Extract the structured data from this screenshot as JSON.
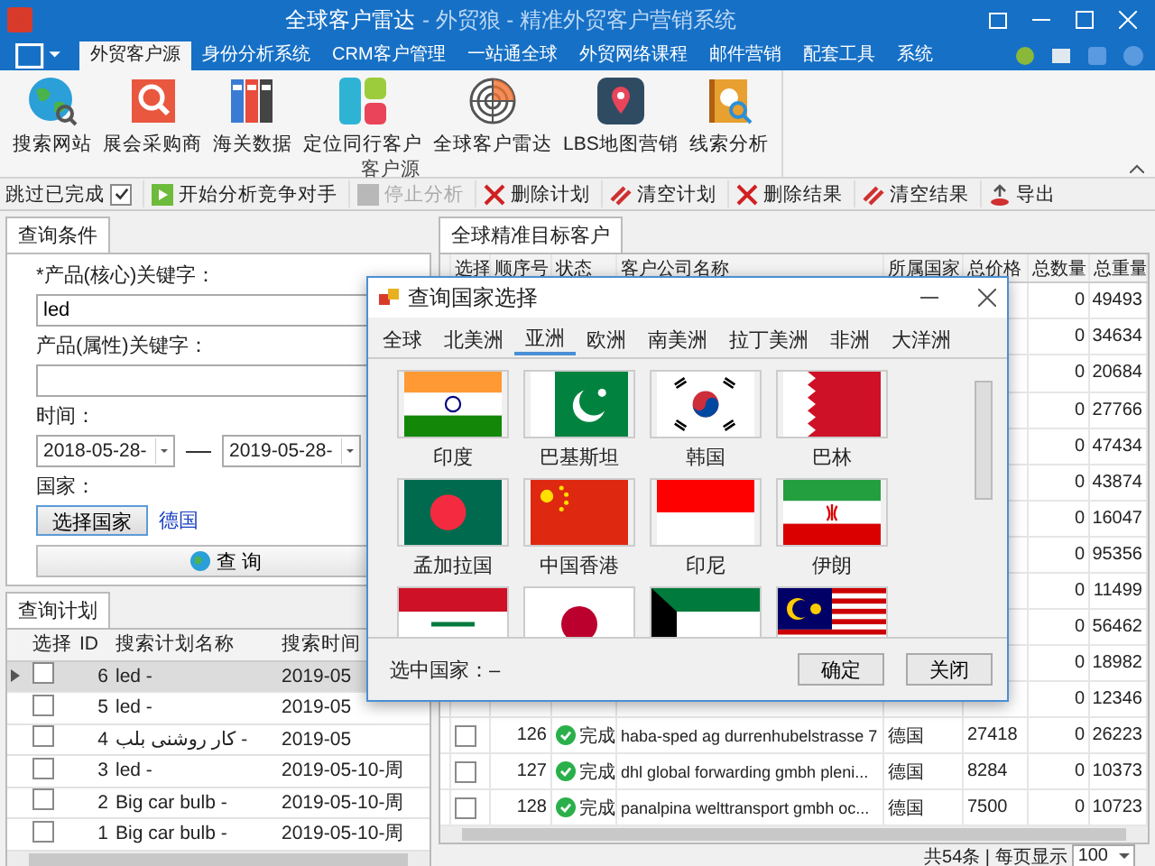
{
  "window": {
    "title": "全球客户雷达",
    "subtitle": "- 外贸狼 - 精准外贸客户营销系统"
  },
  "menu_tabs": [
    {
      "label": "外贸客户源",
      "selected": true
    },
    {
      "label": "身份分析系统",
      "selected": false
    },
    {
      "label": "CRM客户管理",
      "selected": false
    },
    {
      "label": "一站通全球",
      "selected": false
    },
    {
      "label": "外贸网络课程",
      "selected": false
    },
    {
      "label": "邮件营销",
      "selected": false
    },
    {
      "label": "配套工具",
      "selected": false
    },
    {
      "label": "系统",
      "selected": false
    }
  ],
  "ribbon": {
    "group_label": "客户源",
    "buttons": [
      {
        "label": "搜索网站",
        "kind": "globe"
      },
      {
        "label": "展会采购商",
        "kind": "search"
      },
      {
        "label": "海关数据",
        "kind": "binders"
      },
      {
        "label": "定位同行客户",
        "kind": "blocks"
      },
      {
        "label": "全球客户雷达",
        "kind": "radar"
      },
      {
        "label": "LBS地图营销",
        "kind": "pin"
      },
      {
        "label": "线索分析",
        "kind": "book"
      }
    ]
  },
  "toolbar": {
    "skip_done": {
      "label": "跳过已完成",
      "checked": true
    },
    "buttons": [
      {
        "label": "开始分析竞争对手",
        "kind": "play",
        "disabled": false
      },
      {
        "label": "停止分析",
        "kind": "stop",
        "disabled": true
      },
      {
        "label": "删除计划",
        "kind": "delete",
        "disabled": false
      },
      {
        "label": "清空计划",
        "kind": "clear",
        "disabled": false
      },
      {
        "label": "删除结果",
        "kind": "delete",
        "disabled": false
      },
      {
        "label": "清空结果",
        "kind": "clear",
        "disabled": false
      },
      {
        "label": "导出",
        "kind": "export",
        "disabled": false
      }
    ]
  },
  "query_panel": {
    "tab": "查询条件",
    "core_keyword_label": "*产品(核心)关键字：",
    "core_keyword": "led",
    "attr_keyword_label": "产品(属性)关键字：",
    "time_label": "时间：",
    "date_from": "2018-05-28-",
    "date_to": "2019-05-28-",
    "country_label": "国家：",
    "choose_country_button": "选择国家",
    "country_link": "德国",
    "query_button": "查 询"
  },
  "plan_panel": {
    "tab": "查询计划",
    "columns": [
      "选择",
      "ID",
      "搜索计划名称",
      "搜索时间"
    ],
    "rows": [
      {
        "selected": true,
        "checked": false,
        "id": "6",
        "name": "led -",
        "time": "2019-05"
      },
      {
        "selected": false,
        "checked": false,
        "id": "5",
        "name": "led -",
        "time": "2019-05"
      },
      {
        "selected": false,
        "checked": false,
        "id": "4",
        "name": "كار روشنی بلب -",
        "time": "2019-05"
      },
      {
        "selected": false,
        "checked": false,
        "id": "3",
        "name": "led -",
        "time": "2019-05-10-周"
      },
      {
        "selected": false,
        "checked": false,
        "id": "2",
        "name": "Big car bulb -",
        "time": "2019-05-10-周"
      },
      {
        "selected": false,
        "checked": false,
        "id": "1",
        "name": "Big car bulb -",
        "time": "2019-05-10-周"
      }
    ]
  },
  "results_panel": {
    "tab": "全球精准目标客户",
    "columns": [
      "选择",
      "顺序号",
      "状态",
      "客户公司名称",
      "所属国家",
      "总价格",
      "总数量",
      "总重量"
    ],
    "rows": [
      {
        "total_quantity": "0",
        "total_weight": "49493"
      },
      {
        "total_quantity": "0",
        "total_weight": "34634"
      },
      {
        "total_quantity": "0",
        "total_weight": "20684"
      },
      {
        "total_quantity": "0",
        "total_weight": "27766"
      },
      {
        "total_quantity": "0",
        "total_weight": "47434"
      },
      {
        "total_quantity": "0",
        "total_weight": "43874"
      },
      {
        "total_quantity": "0",
        "total_weight": "16047"
      },
      {
        "total_quantity": "0",
        "total_weight": "95356"
      },
      {
        "total_quantity": "0",
        "total_weight": "11499"
      },
      {
        "total_quantity": "0",
        "total_weight": "56462"
      },
      {
        "total_quantity": "0",
        "total_weight": "18982"
      },
      {
        "total_quantity": "0",
        "total_weight": "12346"
      },
      {
        "checked": false,
        "number": "126",
        "status": "完成",
        "company": "haba-sped ag durrenhubelstrasse 7",
        "country": "德国",
        "total_price": "27418",
        "total_quantity": "0",
        "total_weight": "26223"
      },
      {
        "checked": false,
        "number": "127",
        "status": "完成",
        "company": "dhl global forwarding gmbh pleni...",
        "country": "德国",
        "total_price": "8284",
        "total_quantity": "0",
        "total_weight": "10373"
      },
      {
        "checked": false,
        "number": "128",
        "status": "完成",
        "company": "panalpina welttransport gmbh oc...",
        "country": "德国",
        "total_price": "7500",
        "total_quantity": "0",
        "total_weight": "10723"
      }
    ],
    "footer": "共54条 | 每页显示",
    "page_size": "100"
  },
  "dialog": {
    "title": "查询国家选择",
    "tabs": [
      {
        "label": "全球",
        "selected": false
      },
      {
        "label": "北美洲",
        "selected": false
      },
      {
        "label": "亚洲",
        "selected": true
      },
      {
        "label": "欧洲",
        "selected": false
      },
      {
        "label": "南美洲",
        "selected": false
      },
      {
        "label": "拉丁美洲",
        "selected": false
      },
      {
        "label": "非洲",
        "selected": false
      },
      {
        "label": "大洋洲",
        "selected": false
      }
    ],
    "countries": [
      {
        "kind": "india",
        "label": "印度"
      },
      {
        "kind": "pakistan",
        "label": "巴基斯坦"
      },
      {
        "kind": "korea",
        "label": "韩国"
      },
      {
        "kind": "bahrain",
        "label": "巴林"
      },
      {
        "kind": "bangladesh",
        "label": "孟加拉国"
      },
      {
        "kind": "china",
        "label": "中国香港"
      },
      {
        "kind": "indonesia",
        "label": "印尼"
      },
      {
        "kind": "iran",
        "label": "伊朗"
      },
      {
        "kind": "iraq"
      },
      {
        "kind": "japan"
      },
      {
        "kind": "kuwait"
      },
      {
        "kind": "malaysia"
      }
    ],
    "selected_label": "选中国家：–",
    "ok_button": "确定",
    "close_button": "关闭"
  }
}
